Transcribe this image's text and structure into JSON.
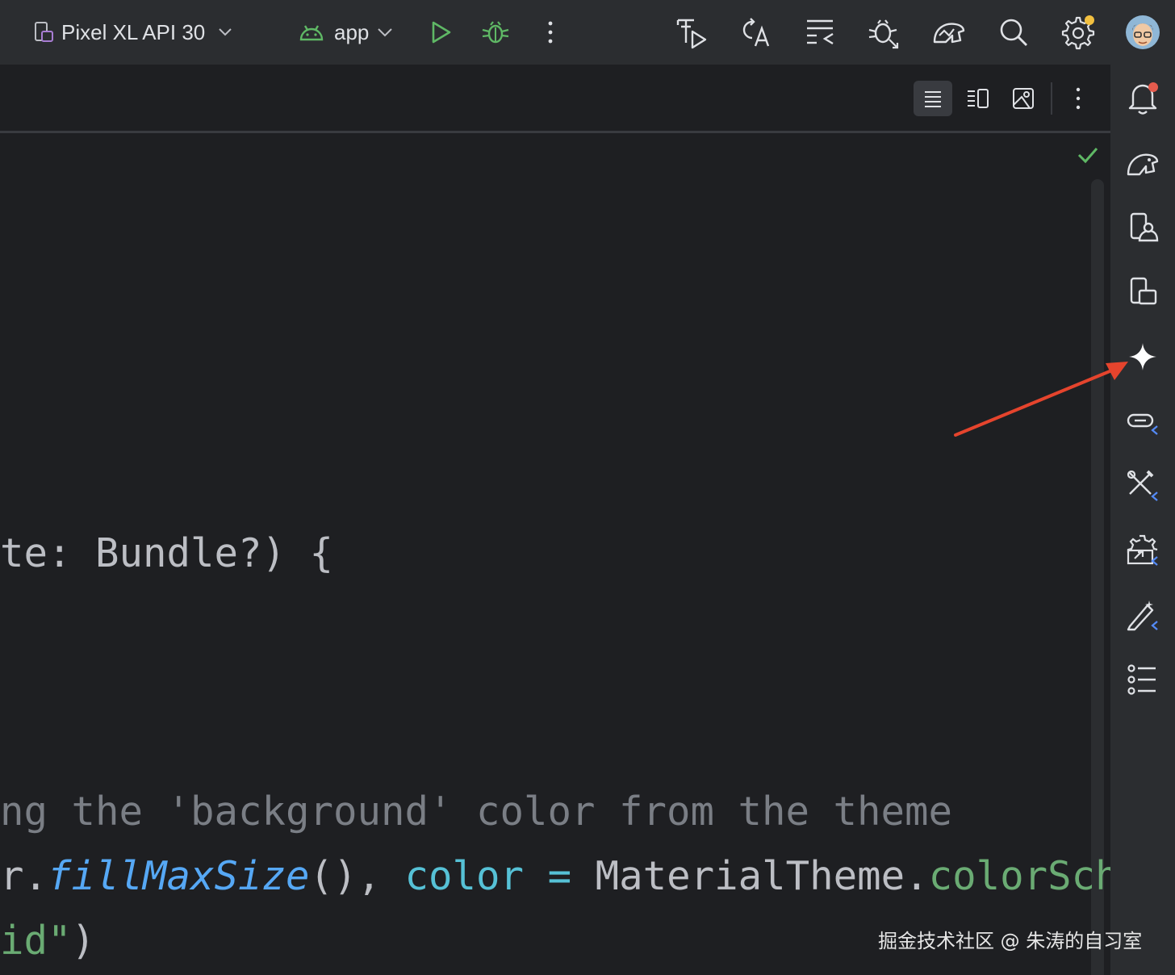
{
  "toolbar": {
    "device_label": "Pixel XL API 30",
    "config_label": "app",
    "icons": [
      "device-icon",
      "chevron-down-icon",
      "android-icon",
      "chevron-down-icon",
      "run-icon",
      "debug-icon",
      "more-vertical-icon",
      "build-icon",
      "translate-icon",
      "wrap-icon",
      "bug-icon",
      "profiler-icon",
      "search-icon",
      "settings-icon",
      "avatar"
    ]
  },
  "editor": {
    "view_modes": [
      "code-view-icon",
      "split-view-icon",
      "design-view-icon"
    ],
    "status": "check-icon",
    "code_lines": [
      {
        "segments": [
          {
            "text": "te: Bundle?) {",
            "cls": "c-plain"
          }
        ]
      },
      {
        "segments": [
          {
            "text": "ng the 'background' color from the theme",
            "cls": "c-comment"
          }
        ]
      },
      {
        "segments": [
          {
            "text": "r.",
            "cls": "c-plain"
          },
          {
            "text": "fillMaxSize",
            "cls": "c-fn"
          },
          {
            "text": "(), ",
            "cls": "c-plain"
          },
          {
            "text": "color",
            "cls": "c-param"
          },
          {
            "text": " = ",
            "cls": "c-op"
          },
          {
            "text": "MaterialTheme.",
            "cls": "c-plain"
          },
          {
            "text": "colorSche",
            "cls": "c-prop"
          }
        ]
      },
      {
        "segments": [
          {
            "text": "id\"",
            "cls": "c-str"
          },
          {
            "text": ")",
            "cls": "c-plain"
          }
        ]
      }
    ]
  },
  "right_strip": {
    "icons": [
      "notifications-icon",
      "gradle-icon",
      "device-manager-icon",
      "running-devices-icon",
      "gemini-icon",
      "api-icon",
      "tools-icon",
      "app-inspection-icon",
      "magic-edit-icon",
      "structure-list-icon"
    ]
  },
  "watermark": "掘金技术社区 @ 朱涛的自习室",
  "colors": {
    "toolbar_bg": "#2b2d30",
    "editor_bg": "#1e1f22",
    "accent_green": "#5fb865",
    "annotation_red": "#e5442d",
    "ai_blue": "#548af7"
  }
}
